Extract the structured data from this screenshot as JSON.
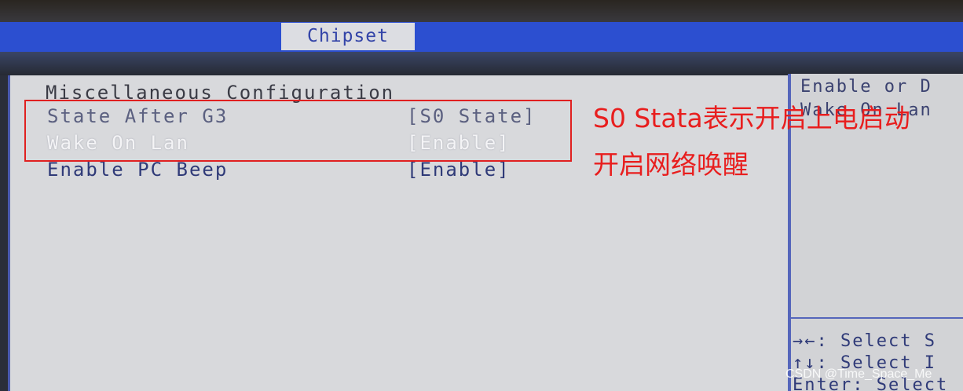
{
  "menu": {
    "active_tab": "Chipset"
  },
  "main": {
    "section_title": "Miscellaneous Configuration",
    "settings": [
      {
        "label": "State After G3",
        "value": "[S0 State]"
      },
      {
        "label": "Wake On Lan",
        "value": "[Enable]"
      },
      {
        "label": "Enable PC Beep",
        "value": "[Enable]"
      }
    ]
  },
  "help": {
    "line1": "Enable or D",
    "line2": "Wake On Lan",
    "keys": [
      "→←: Select S",
      "↑↓: Select I",
      "Enter: Select"
    ]
  },
  "annotations": {
    "line1": "S0 Stata表示开启上电启动",
    "line2": "开启网络唤醒"
  },
  "watermark": "CSDN @Time_Space_Me",
  "colors": {
    "menu_bar": "#2c4fd0",
    "panel": "#d8d9dc",
    "highlight": "#f4f4f6",
    "annotation": "#e81e1e"
  }
}
